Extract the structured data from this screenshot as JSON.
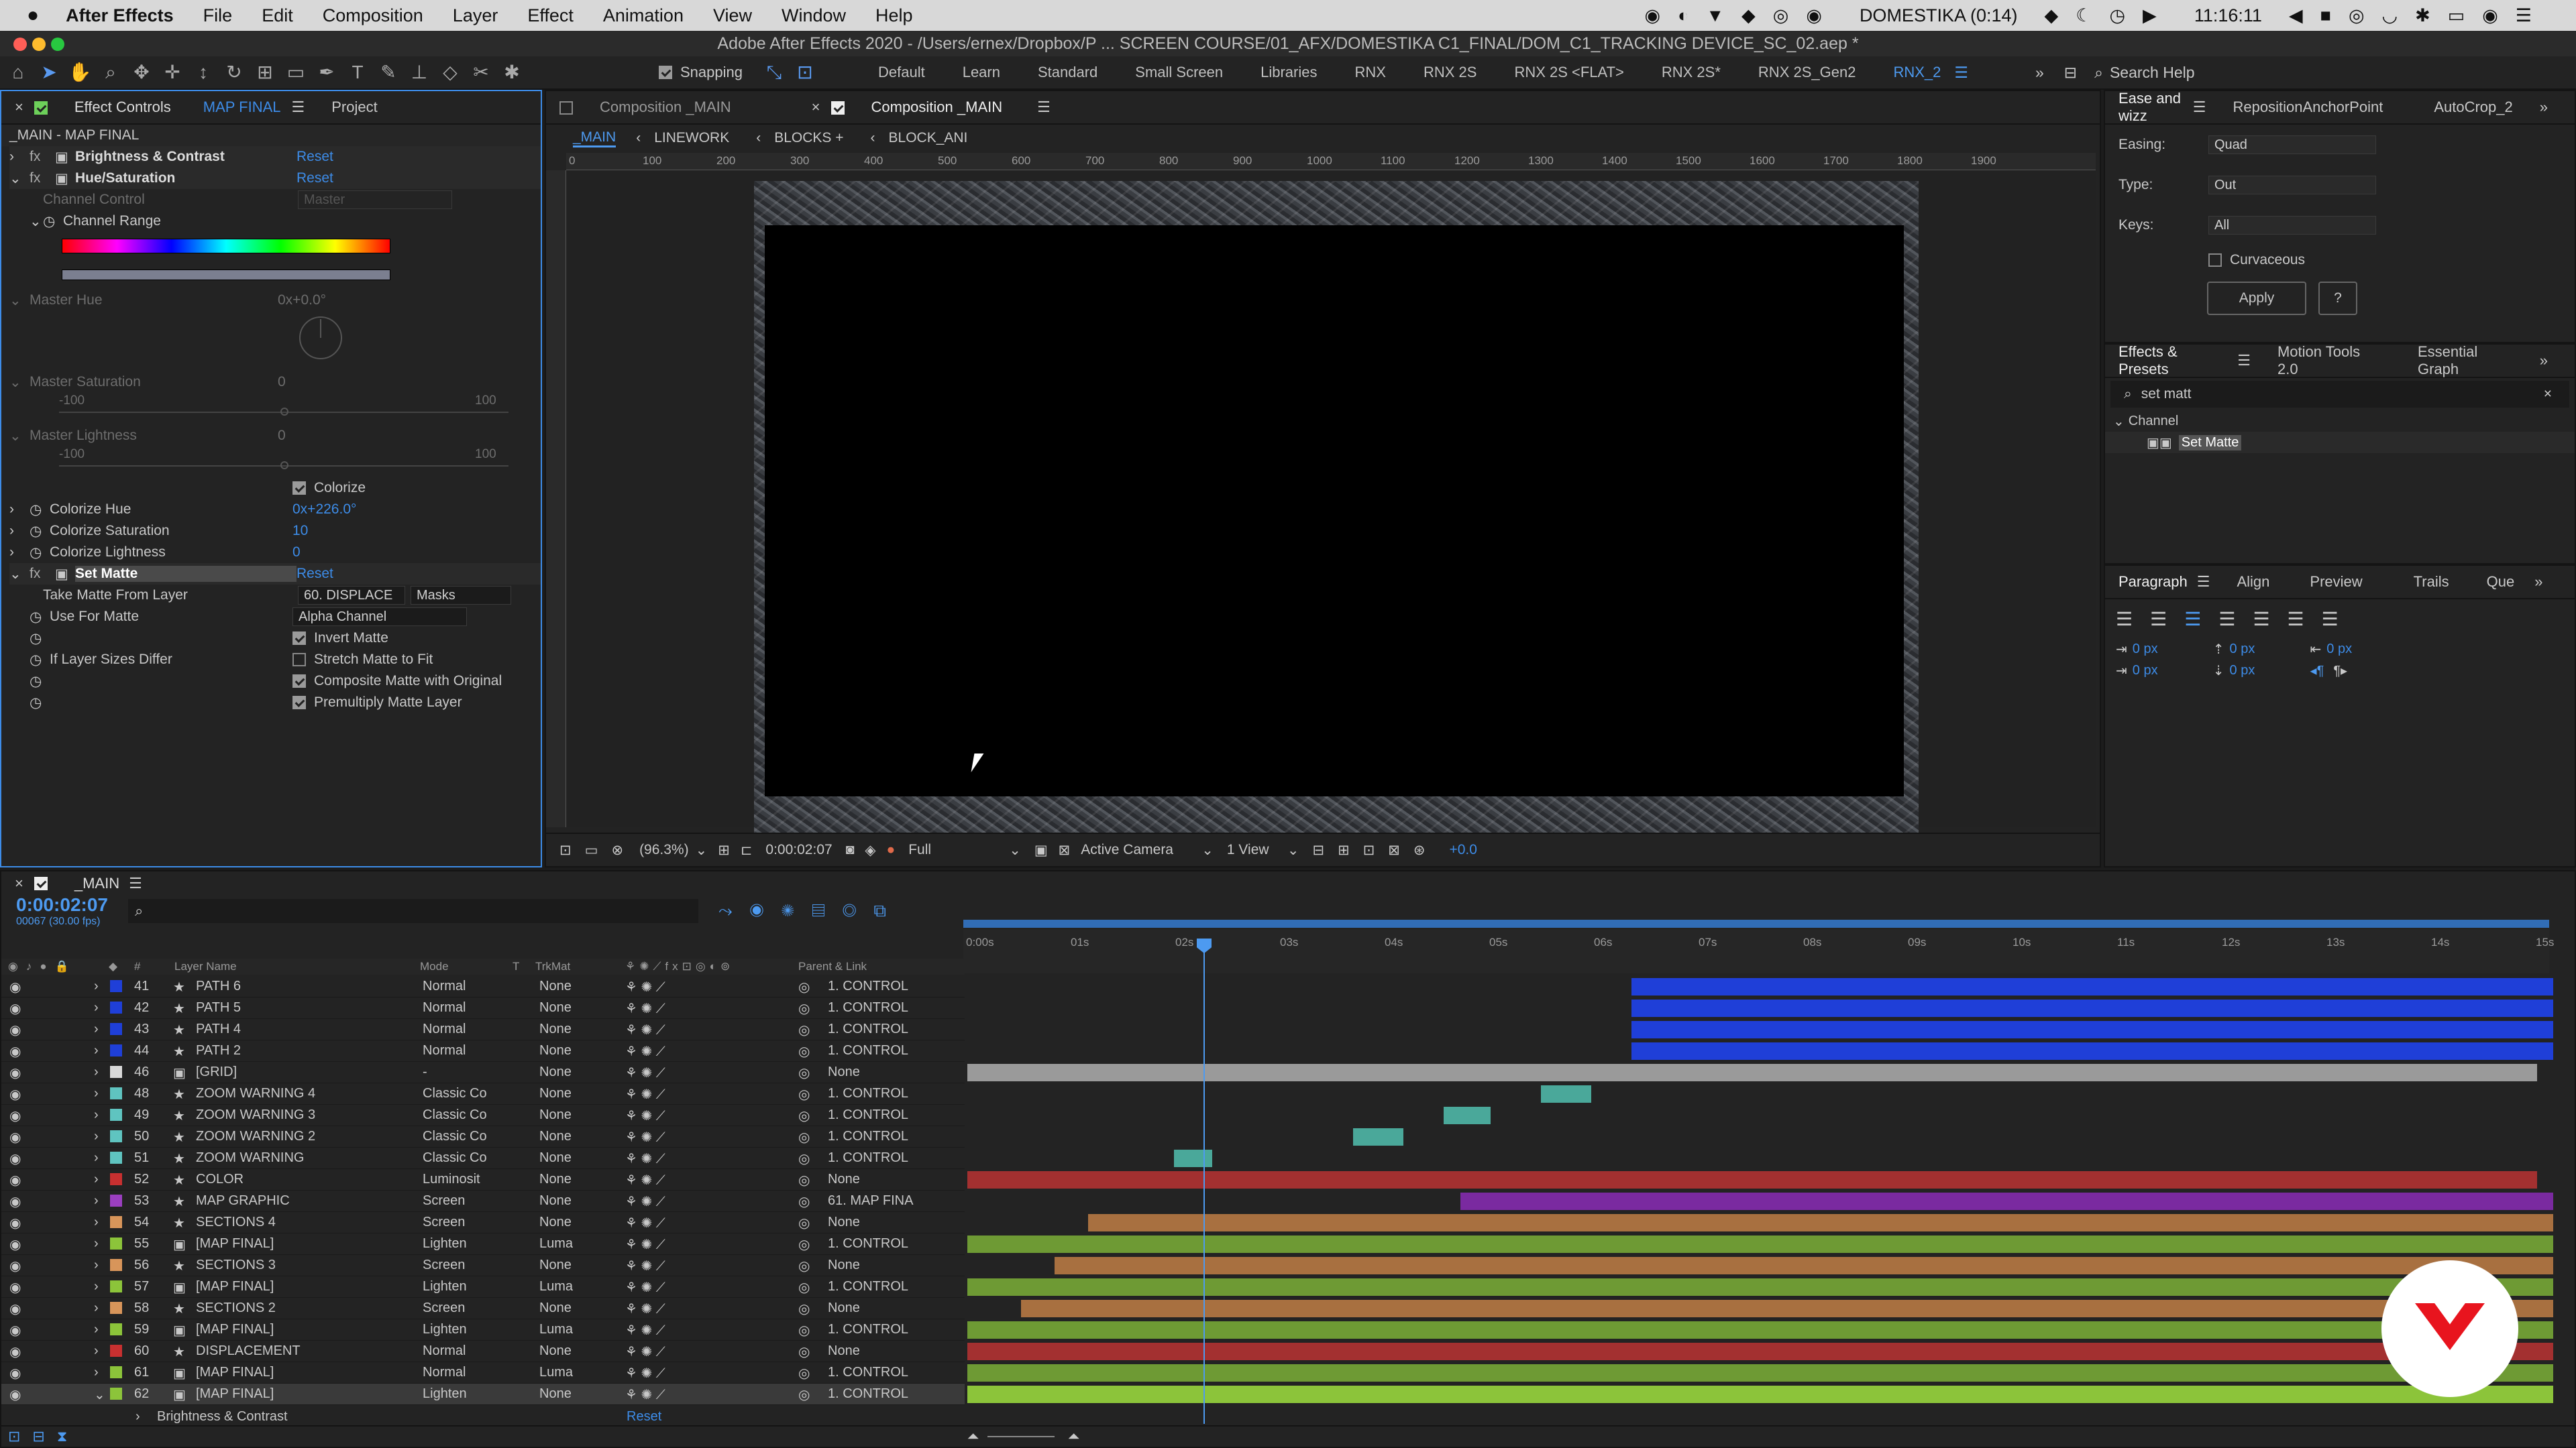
{
  "menubar": {
    "app": "After Effects",
    "items": [
      "File",
      "Edit",
      "Composition",
      "Layer",
      "Effect",
      "Animation",
      "View",
      "Window",
      "Help"
    ],
    "status_user": "DOMESTIKA (0:14)",
    "clock": "11:16:11"
  },
  "window": {
    "title": "Adobe After Effects 2020 - /Users/ernex/Dropbox/P ...  SCREEN COURSE/01_AFX/DOMESTIKA C1_FINAL/DOM_C1_TRACKING DEVICE_SC_02.aep *"
  },
  "toolbar": {
    "snapping_label": "Snapping",
    "workspaces": [
      "Default",
      "Learn",
      "Standard",
      "Small Screen",
      "Libraries",
      "RNX",
      "RNX 2S",
      "RNX 2S <FLAT>",
      "RNX 2S*",
      "RNX 2S_Gen2",
      "RNX_2"
    ],
    "search_placeholder": "Search Help"
  },
  "effect_controls": {
    "tab_label": "Effect Controls",
    "tab_layer": "MAP FINAL",
    "project_tab": "Project",
    "header": "_MAIN - MAP FINAL",
    "brightness": {
      "name": "Brightness & Contrast",
      "reset": "Reset"
    },
    "hue": {
      "name": "Hue/Saturation",
      "reset": "Reset",
      "channel_control": "Channel Control",
      "channel_control_value": "Master",
      "channel_range": "Channel Range",
      "master_hue": "Master Hue",
      "master_hue_value": "0x+0.0°",
      "master_saturation": "Master Saturation",
      "master_saturation_value": "0",
      "master_lightness": "Master Lightness",
      "master_lightness_value": "0",
      "min": "-100",
      "max": "100",
      "colorize": "Colorize",
      "colorize_hue": "Colorize Hue",
      "colorize_hue_value": "0x+226.0°",
      "colorize_saturation": "Colorize Saturation",
      "colorize_saturation_value": "10",
      "colorize_lightness": "Colorize Lightness",
      "colorize_lightness_value": "0"
    },
    "set_matte": {
      "name": "Set Matte",
      "reset": "Reset",
      "take_from": "Take Matte From Layer",
      "take_from_value": "60. DISPLACE",
      "take_from_mode": "Masks",
      "use_for": "Use For Matte",
      "use_for_value": "Alpha Channel",
      "invert": "Invert Matte",
      "if_sizes": "If Layer Sizes Differ",
      "stretch": "Stretch Matte to Fit",
      "composite": "Composite Matte with Original",
      "premultiply": "Premultiply Matte Layer"
    }
  },
  "composition": {
    "tab1": "Composition _MAIN",
    "tab2": "Composition _MAIN",
    "breadcrumbs": [
      "_MAIN",
      "LINEWORK",
      "BLOCKS +",
      "BLOCK_ANI"
    ],
    "ruler_labels": [
      "0",
      "100",
      "200",
      "300",
      "400",
      "500",
      "600",
      "700",
      "800",
      "900",
      "1000",
      "1100",
      "1200",
      "1300",
      "1400",
      "1500",
      "1600",
      "1700",
      "1800",
      "1900"
    ],
    "zoom": "(96.3%)",
    "timecode": "0:00:02:07",
    "resolution": "Full",
    "camera": "Active Camera",
    "views": "1 View",
    "exposure": "+0.0"
  },
  "ease": {
    "tabs": [
      "Ease and wizz",
      "RepositionAnchorPoint",
      "AutoCrop_2"
    ],
    "easing_label": "Easing:",
    "easing": "Quad",
    "type_label": "Type:",
    "type": "Out",
    "keys_label": "Keys:",
    "keys": "All",
    "curvaceous": "Curvaceous",
    "apply": "Apply",
    "help": "?"
  },
  "effects_presets": {
    "tabs": [
      "Effects & Presets",
      "Motion Tools 2.0",
      "Essential Graph"
    ],
    "search_value": "set matt",
    "category": "Channel",
    "item": "Set Matte"
  },
  "paragraph": {
    "tabs": [
      "Paragraph",
      "Align",
      "Preview",
      "Trails",
      "Que"
    ],
    "values": [
      "0 px",
      "0 px",
      "0 px",
      "0 px",
      "0 px"
    ]
  },
  "timeline": {
    "comp_name": "_MAIN",
    "timecode": "0:00:02:07",
    "fps": "00067 (30.00 fps)",
    "columns": {
      "num": "#",
      "name": "Layer Name",
      "mode": "Mode",
      "t": "T",
      "trkmat": "TrkMat",
      "parent": "Parent & Link"
    },
    "time_labels": [
      "0:00s",
      "01s",
      "02s",
      "03s",
      "04s",
      "05s",
      "06s",
      "07s",
      "08s",
      "09s",
      "10s",
      "11s",
      "12s",
      "13s",
      "14s",
      "15s"
    ],
    "layers": [
      {
        "num": "41",
        "name": "PATH 6",
        "mode": "Normal",
        "trk": "None",
        "parent": "1. CONTROL",
        "color": "#1f3fd8"
      },
      {
        "num": "42",
        "name": "PATH 5",
        "mode": "Normal",
        "trk": "None",
        "parent": "1. CONTROL",
        "color": "#1f3fd8"
      },
      {
        "num": "43",
        "name": "PATH 4",
        "mode": "Normal",
        "trk": "None",
        "parent": "1. CONTROL",
        "color": "#1f3fd8"
      },
      {
        "num": "44",
        "name": "PATH 2",
        "mode": "Normal",
        "trk": "None",
        "parent": "1. CONTROL",
        "color": "#1f3fd8"
      },
      {
        "num": "46",
        "name": "[GRID]",
        "mode": "-",
        "trk": "None",
        "parent": "None",
        "color": "#d8d8d8"
      },
      {
        "num": "48",
        "name": "ZOOM WARNING 4",
        "mode": "Classic Co",
        "trk": "None",
        "parent": "1. CONTROL",
        "color": "#5fc4c0"
      },
      {
        "num": "49",
        "name": "ZOOM WARNING 3",
        "mode": "Classic Co",
        "trk": "None",
        "parent": "1. CONTROL",
        "color": "#5fc4c0"
      },
      {
        "num": "50",
        "name": "ZOOM WARNING 2",
        "mode": "Classic Co",
        "trk": "None",
        "parent": "1. CONTROL",
        "color": "#5fc4c0"
      },
      {
        "num": "51",
        "name": "ZOOM WARNING",
        "mode": "Classic Co",
        "trk": "None",
        "parent": "1. CONTROL",
        "color": "#5fc4c0"
      },
      {
        "num": "52",
        "name": "COLOR",
        "mode": "Luminosit",
        "trk": "None",
        "parent": "None",
        "color": "#c83030"
      },
      {
        "num": "53",
        "name": "MAP GRAPHIC",
        "mode": "Screen",
        "trk": "None",
        "parent": "61. MAP FINA",
        "color": "#9b3fc0"
      },
      {
        "num": "54",
        "name": "SECTIONS 4",
        "mode": "Screen",
        "trk": "None",
        "parent": "None",
        "color": "#d8955a"
      },
      {
        "num": "55",
        "name": "[MAP FINAL]",
        "mode": "Lighten",
        "trk": "Luma",
        "parent": "1. CONTROL",
        "color": "#8cc43a"
      },
      {
        "num": "56",
        "name": "SECTIONS 3",
        "mode": "Screen",
        "trk": "None",
        "parent": "None",
        "color": "#d8955a"
      },
      {
        "num": "57",
        "name": "[MAP FINAL]",
        "mode": "Lighten",
        "trk": "Luma",
        "parent": "1. CONTROL",
        "color": "#8cc43a"
      },
      {
        "num": "58",
        "name": "SECTIONS 2",
        "mode": "Screen",
        "trk": "None",
        "parent": "None",
        "color": "#d8955a"
      },
      {
        "num": "59",
        "name": "[MAP FINAL]",
        "mode": "Lighten",
        "trk": "Luma",
        "parent": "1. CONTROL",
        "color": "#8cc43a"
      },
      {
        "num": "60",
        "name": "DISPLACEMENT",
        "mode": "Normal",
        "trk": "None",
        "parent": "None",
        "color": "#c83030"
      },
      {
        "num": "61",
        "name": "[MAP FINAL]",
        "mode": "Normal",
        "trk": "Luma",
        "parent": "1. CONTROL",
        "color": "#8cc43a"
      },
      {
        "num": "62",
        "name": "[MAP FINAL]",
        "mode": "Lighten",
        "trk": "None",
        "parent": "1. CONTROL",
        "color": "#8cc43a"
      }
    ],
    "sub_row_label": "Brightness & Contrast",
    "sub_row_reset": "Reset"
  }
}
